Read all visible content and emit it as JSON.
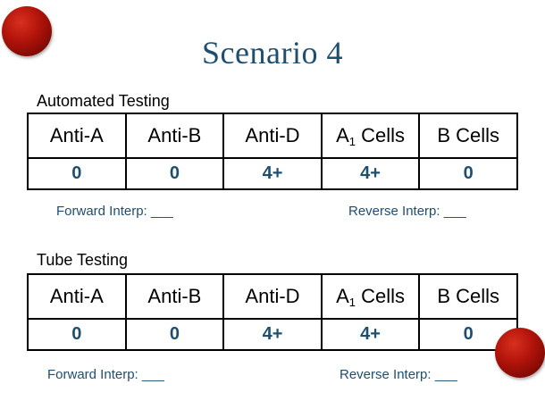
{
  "slide": {
    "title": "Scenario 4"
  },
  "automated": {
    "label": "Automated Testing",
    "headers": [
      "Anti-A",
      "Anti-B",
      "Anti-D",
      "Cells",
      "B Cells"
    ],
    "a1_prefix": "A",
    "a1_subscript": "1",
    "values": [
      "0",
      "0",
      "4+",
      "4+",
      "0"
    ],
    "forward_interp": "Forward Interp: ___",
    "reverse_interp": "Reverse Interp: ___"
  },
  "tube": {
    "label": "Tube Testing",
    "headers": [
      "Anti-A",
      "Anti-B",
      "Anti-D",
      "Cells",
      "B Cells"
    ],
    "a1_prefix": "A",
    "a1_subscript": "1",
    "values": [
      "0",
      "0",
      "4+",
      "4+",
      "0"
    ],
    "forward_interp": "Forward Interp: ___",
    "reverse_interp": "Reverse Interp: ___"
  },
  "colors": {
    "title": "#1f4e6e",
    "values": "#1f4e6e",
    "ball": "#b3140b"
  }
}
